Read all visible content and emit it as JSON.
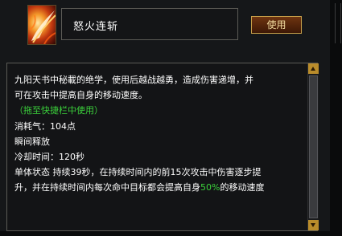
{
  "skill": {
    "name": "怒火连斩",
    "icon": "flaming-blade-icon"
  },
  "actions": {
    "use_label": "使用"
  },
  "description": {
    "line1": "九阳天书中秘載的绝学，使用后越战越勇，造成伤害递增，并",
    "line2": "可在攻击中提高自身的移动速度。",
    "hint": "（拖至快捷栏中使用）",
    "cost": "消耗气：104点",
    "cast": "瞬间释放",
    "cooldown": "冷却时间：120秒",
    "state_line1": "单体状态  持续39秒，在持续时间内的前15次攻击中伤害逐步提",
    "state_line2_a": "升，并在持续时间内每次命中目标都会提高自身",
    "state_line2_value": "50%",
    "state_line2_b": "的移动速度"
  },
  "colors": {
    "highlight": "#3bd13b",
    "button_border": "#c8a14a",
    "scroll_arrow": "#b98c2b"
  }
}
